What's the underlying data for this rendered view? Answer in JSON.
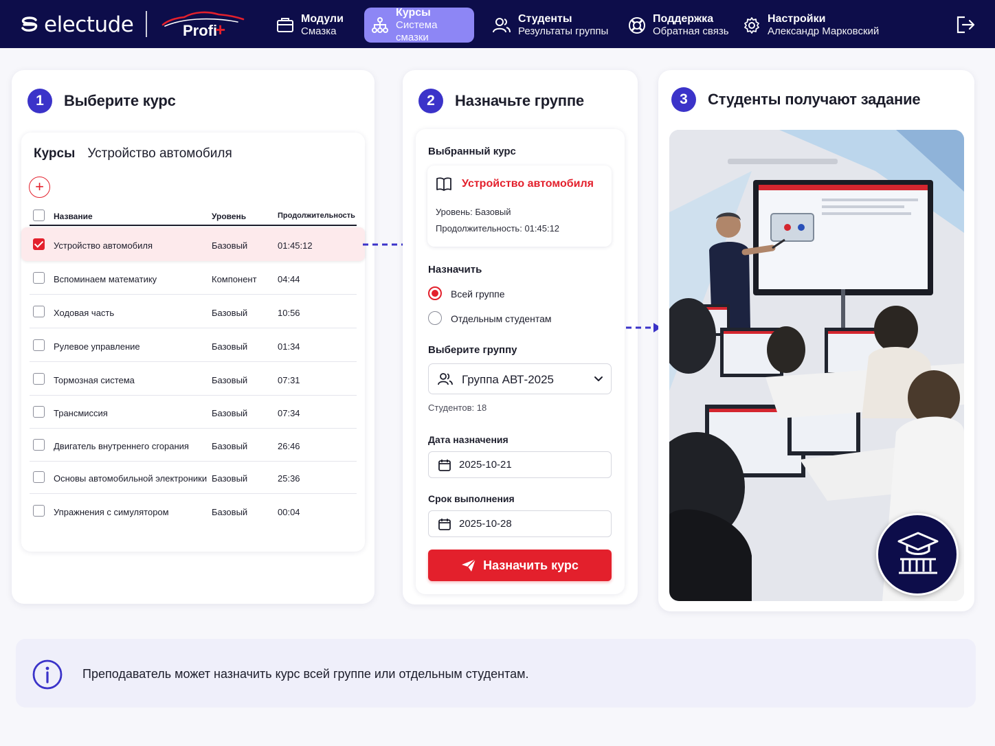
{
  "brand": {
    "name": "electude",
    "product": "Profi",
    "product_plus": "+"
  },
  "nav": [
    {
      "title": "Модули",
      "subtitle": "Смазка",
      "icon": "modules-icon",
      "active": false
    },
    {
      "title": "Курсы",
      "subtitle": "Система смазки",
      "icon": "courses-icon",
      "active": true
    },
    {
      "title": "Студенты",
      "subtitle": "Результаты группы",
      "icon": "students-icon",
      "active": false
    },
    {
      "title": "Поддержка",
      "subtitle": "Обратная связь",
      "icon": "support-icon",
      "active": false
    },
    {
      "title": "Настройки",
      "subtitle": "Александр Марковский",
      "icon": "settings-icon",
      "active": false
    }
  ],
  "steps": {
    "step1": {
      "num": "1",
      "title": "Выберите курс"
    },
    "step2": {
      "num": "2",
      "title": "Назначьте группе"
    },
    "step3": {
      "num": "3",
      "title": "Студенты получают задание"
    }
  },
  "courses_panel": {
    "tab_active": "Курсы",
    "tab_context": "Устройство автомобиля",
    "add_label": "+",
    "columns": [
      "Название",
      "Уровень",
      "Продолжительность"
    ],
    "rows": [
      {
        "name": "Устройство автомобиля",
        "level": "Базовый",
        "duration": "01:45:12",
        "checked": true
      },
      {
        "name": "Вспоминаем математику",
        "level": "Компонент",
        "duration": "04:44",
        "checked": false
      },
      {
        "name": "Ходовая часть",
        "level": "Базовый",
        "duration": "10:56",
        "checked": false
      },
      {
        "name": "Рулевое управление",
        "level": "Базовый",
        "duration": "01:34",
        "checked": false
      },
      {
        "name": "Тормозная система",
        "level": "Базовый",
        "duration": "07:31",
        "checked": false
      },
      {
        "name": "Трансмиссия",
        "level": "Базовый",
        "duration": "07:34",
        "checked": false
      },
      {
        "name": "Двигатель внутреннего сгорания",
        "level": "Базовый",
        "duration": "26:46",
        "checked": false
      },
      {
        "name": "Основы автомобильной электроники",
        "level": "Базовый",
        "duration": "25:36",
        "checked": false
      },
      {
        "name": "Упражнения с симулятором",
        "level": "Базовый",
        "duration": "00:04",
        "checked": false
      }
    ]
  },
  "assign_panel": {
    "selected_label": "Выбранный курс",
    "course_name": "Устройство автомобиля",
    "level_label": "Уровень:",
    "level_value": "Базовый",
    "duration_label": "Продолжительность:",
    "duration_value": "01:45:12",
    "assign_label": "Назначить",
    "option_group": "Всей группе",
    "option_students": "Отдельным студентам",
    "group_label": "Выберите группу",
    "group_value": "Группа АВТ-2025",
    "students_count": "Студентов: 18",
    "date_label": "Дата назначения",
    "date_value": "2025-10-21",
    "due_label": "Срок выполнения",
    "due_value": "2025-10-28",
    "button_label": "Назначить курс"
  },
  "info": {
    "text": "Преподаватель может назначить курс всей группе или отдельным студентам."
  },
  "colors": {
    "navy": "#0d0d4a",
    "accent": "#3b33c9",
    "active_tab": "#8d86f5",
    "red": "#e3202c"
  }
}
